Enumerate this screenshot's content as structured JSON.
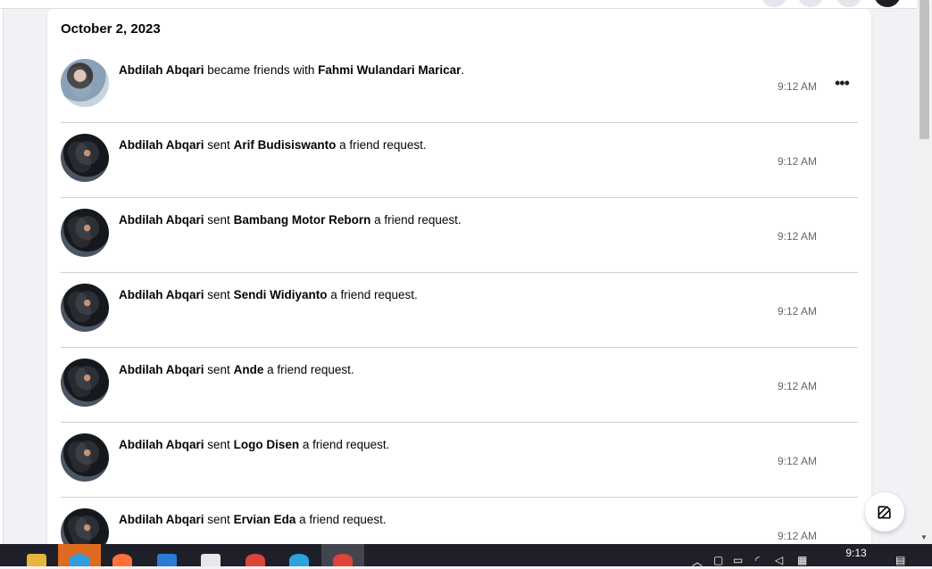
{
  "section": {
    "date": "October 2, 2023"
  },
  "activities": [
    {
      "actor": "Abdilah Abqari",
      "verb": "became friends with",
      "target": "Fahmi Wulandari Maricar",
      "suffix": ".",
      "time": "9:12 AM",
      "avatar": "couple"
    },
    {
      "actor": "Abdilah Abqari",
      "verb": "sent",
      "target": "Arif Budisiswanto",
      "suffix": "a friend request.",
      "time": "9:12 AM",
      "avatar": "moto"
    },
    {
      "actor": "Abdilah Abqari",
      "verb": "sent",
      "target": "Bambang Motor Reborn",
      "suffix": "a friend request.",
      "time": "9:12 AM",
      "avatar": "moto"
    },
    {
      "actor": "Abdilah Abqari",
      "verb": "sent",
      "target": "Sendi Widiyanto",
      "suffix": "a friend request.",
      "time": "9:12 AM",
      "avatar": "moto"
    },
    {
      "actor": "Abdilah Abqari",
      "verb": "sent",
      "target": "Ande",
      "suffix": "a friend request.",
      "time": "9:12 AM",
      "avatar": "moto"
    },
    {
      "actor": "Abdilah Abqari",
      "verb": "sent",
      "target": "Logo Disen",
      "suffix": "a friend request.",
      "time": "9:12 AM",
      "avatar": "moto"
    },
    {
      "actor": "Abdilah Abqari",
      "verb": "sent",
      "target": "Ervian Eda",
      "suffix": "a friend request.",
      "time": "9:12 AM",
      "avatar": "moto"
    }
  ],
  "row_menu": {
    "more_label": "•••"
  },
  "taskbar": {
    "apps": [
      "file-explorer-icon",
      "edge-icon",
      "firefox-icon",
      "mail-icon",
      "store-icon",
      "chrome-icon",
      "telegram-icon",
      "chrome-icon"
    ],
    "clock_time": "9:13"
  },
  "colors": {
    "text": "#050505",
    "secondary": "#65676b",
    "divider": "#ced0d4",
    "background": "#f0f2f5"
  }
}
